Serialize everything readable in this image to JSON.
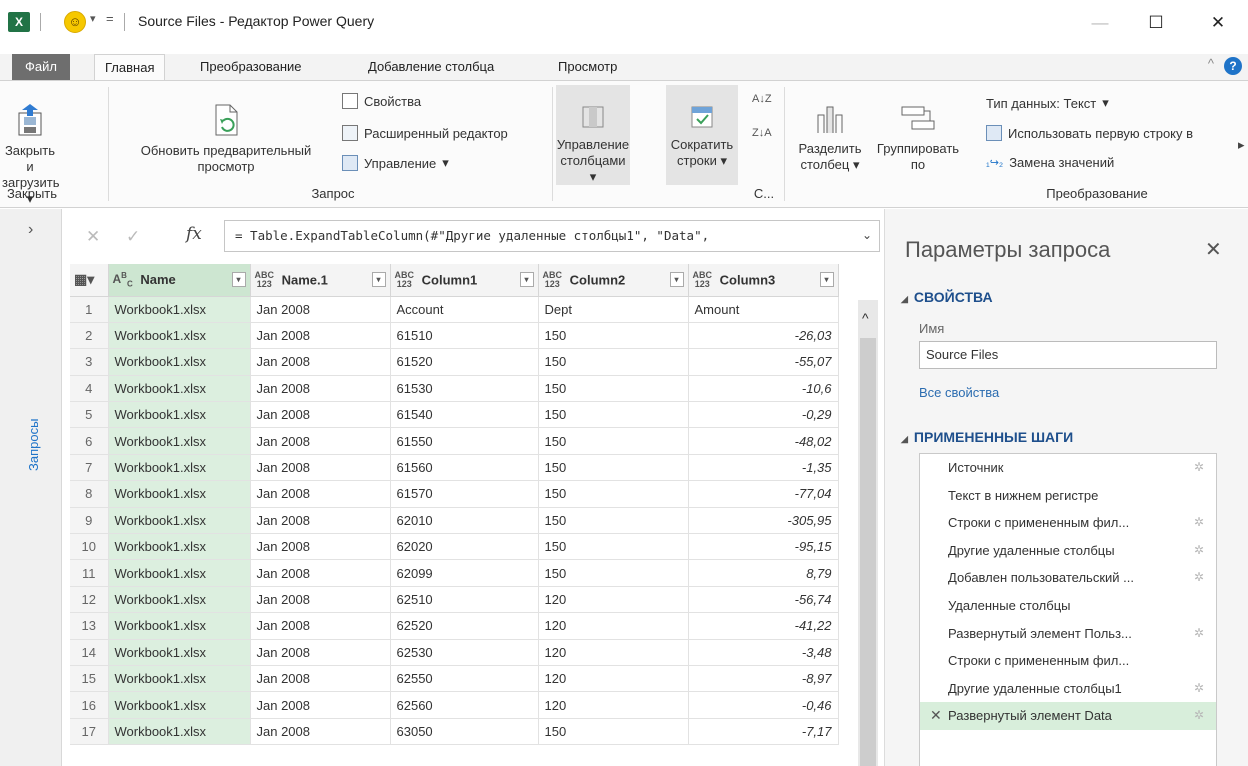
{
  "window": {
    "app_icon": "X",
    "title": "Source Files - Редактор Power Query",
    "quick_access_arrow": "▾",
    "menu_arrow": "=",
    "minimize": "—",
    "maximize": "☐",
    "close": "✕"
  },
  "tabs": [
    {
      "label": "Файл"
    },
    {
      "label": "Главная"
    },
    {
      "label": "Преобразование"
    },
    {
      "label": "Добавление столбца"
    },
    {
      "label": "Просмотр"
    }
  ],
  "ribbon": {
    "close_load": "Закрыть и загрузить",
    "close_load_arrow": "▾",
    "group_close": "Закрыть",
    "refresh_preview": "Обновить предварительный просмотр",
    "properties": "Свойства",
    "advanced_editor": "Расширенный редактор",
    "manage": "Управление",
    "group_query": "Запрос",
    "manage_columns": "Управление столбцами",
    "reduce_rows": "Сократить строки",
    "group_sort": "С...",
    "split_column": "Разделить столбец",
    "group_by": "Группировать по",
    "data_type": "Тип данных: Текст",
    "use_first_row": "Использовать первую строку в",
    "replace_values": "Замена значений",
    "group_transform": "Преобразование",
    "overflow": "▸"
  },
  "sidebar": {
    "label": "Запросы",
    "expand": "›"
  },
  "formula_bar": {
    "cancel": "✕",
    "confirm": "✓",
    "fx": "fx",
    "formula": "= Table.ExpandTableColumn(#\"Другие удаленные столбцы1\", \"Data\",",
    "expand": "⌄"
  },
  "grid": {
    "columns": [
      {
        "type_icon": "ABC",
        "type_top": "A",
        "type_bottom": "C",
        "name": "Name"
      },
      {
        "type_top": "ABC",
        "type_bottom": "123",
        "name": "Name.1"
      },
      {
        "type_top": "ABC",
        "type_bottom": "123",
        "name": "Column1"
      },
      {
        "type_top": "ABC",
        "type_bottom": "123",
        "name": "Column2"
      },
      {
        "type_top": "ABC",
        "type_bottom": "123",
        "name": "Column3"
      }
    ],
    "rows": [
      {
        "n": "1",
        "c": [
          "Workbook1.xlsx",
          "Jan 2008",
          "Account",
          "Dept",
          "Amount"
        ]
      },
      {
        "n": "2",
        "c": [
          "Workbook1.xlsx",
          "Jan 2008",
          "61510",
          "150",
          "-26,03"
        ]
      },
      {
        "n": "3",
        "c": [
          "Workbook1.xlsx",
          "Jan 2008",
          "61520",
          "150",
          "-55,07"
        ]
      },
      {
        "n": "4",
        "c": [
          "Workbook1.xlsx",
          "Jan 2008",
          "61530",
          "150",
          "-10,6"
        ]
      },
      {
        "n": "5",
        "c": [
          "Workbook1.xlsx",
          "Jan 2008",
          "61540",
          "150",
          "-0,29"
        ]
      },
      {
        "n": "6",
        "c": [
          "Workbook1.xlsx",
          "Jan 2008",
          "61550",
          "150",
          "-48,02"
        ]
      },
      {
        "n": "7",
        "c": [
          "Workbook1.xlsx",
          "Jan 2008",
          "61560",
          "150",
          "-1,35"
        ]
      },
      {
        "n": "8",
        "c": [
          "Workbook1.xlsx",
          "Jan 2008",
          "61570",
          "150",
          "-77,04"
        ]
      },
      {
        "n": "9",
        "c": [
          "Workbook1.xlsx",
          "Jan 2008",
          "62010",
          "150",
          "-305,95"
        ]
      },
      {
        "n": "10",
        "c": [
          "Workbook1.xlsx",
          "Jan 2008",
          "62020",
          "150",
          "-95,15"
        ]
      },
      {
        "n": "11",
        "c": [
          "Workbook1.xlsx",
          "Jan 2008",
          "62099",
          "150",
          "8,79"
        ]
      },
      {
        "n": "12",
        "c": [
          "Workbook1.xlsx",
          "Jan 2008",
          "62510",
          "120",
          "-56,74"
        ]
      },
      {
        "n": "13",
        "c": [
          "Workbook1.xlsx",
          "Jan 2008",
          "62520",
          "120",
          "-41,22"
        ]
      },
      {
        "n": "14",
        "c": [
          "Workbook1.xlsx",
          "Jan 2008",
          "62530",
          "120",
          "-3,48"
        ]
      },
      {
        "n": "15",
        "c": [
          "Workbook1.xlsx",
          "Jan 2008",
          "62550",
          "120",
          "-8,97"
        ]
      },
      {
        "n": "16",
        "c": [
          "Workbook1.xlsx",
          "Jan 2008",
          "62560",
          "120",
          "-0,46"
        ]
      },
      {
        "n": "17",
        "c": [
          "Workbook1.xlsx",
          "Jan 2008",
          "63050",
          "150",
          "-7,17"
        ]
      }
    ]
  },
  "settings": {
    "title": "Параметры запроса",
    "close": "✕",
    "properties_header": "СВОЙСТВА",
    "name_label": "Имя",
    "name_value": "Source Files",
    "all_properties": "Все свойства",
    "steps_header": "ПРИМЕНЕННЫЕ ШАГИ",
    "steps": [
      {
        "label": "Источник",
        "gear": true,
        "active": false
      },
      {
        "label": "Текст в нижнем регистре",
        "gear": false,
        "active": false
      },
      {
        "label": "Строки с примененным фил...",
        "gear": true,
        "active": false
      },
      {
        "label": "Другие удаленные столбцы",
        "gear": true,
        "active": false
      },
      {
        "label": "Добавлен пользовательский ...",
        "gear": true,
        "active": false
      },
      {
        "label": "Удаленные столбцы",
        "gear": false,
        "active": false
      },
      {
        "label": "Развернутый элемент Польз...",
        "gear": true,
        "active": false
      },
      {
        "label": "Строки с примененным фил...",
        "gear": false,
        "active": false
      },
      {
        "label": "Другие удаленные столбцы1",
        "gear": true,
        "active": false
      },
      {
        "label": "Развернутый элемент Data",
        "gear": true,
        "active": true
      }
    ]
  },
  "colors": {
    "excel_green": "#217346",
    "selected_column": "#dcefdf",
    "active_step": "#d8eedb",
    "link_blue": "#2b6cb0",
    "header_blue": "#1e4f8c"
  }
}
